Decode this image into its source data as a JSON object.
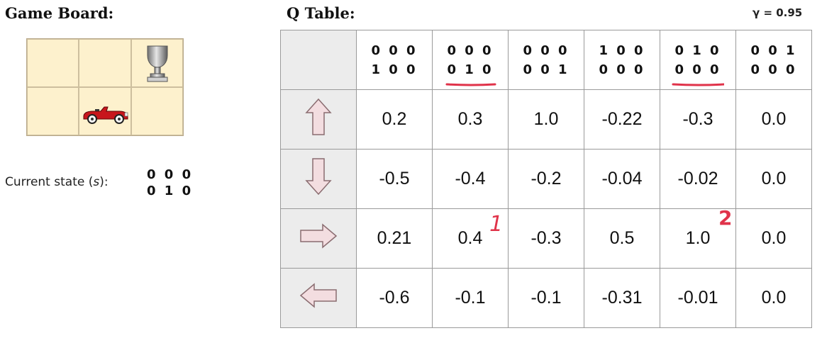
{
  "game_board": {
    "title": "Game Board:",
    "cells": [
      {
        "icon": ""
      },
      {
        "icon": ""
      },
      {
        "icon": "trophy-icon"
      },
      {
        "icon": ""
      },
      {
        "icon": "car-icon"
      },
      {
        "icon": ""
      }
    ],
    "colors": {
      "board_bg": "#fdf1cd",
      "car": "#c8161c",
      "trophy": "#9a9a9a"
    }
  },
  "current_state": {
    "label_prefix": "Current state (",
    "label_var": "s",
    "label_suffix": "):",
    "line1": "0 0 0",
    "line2": "0 1 0"
  },
  "q_table": {
    "title": "Q Table:",
    "gamma": "γ = 0.95",
    "columns": [
      {
        "line1": "0 0 0",
        "line2": "1 0 0",
        "underlined": false
      },
      {
        "line1": "0 0 0",
        "line2": "0 1 0",
        "underlined": true
      },
      {
        "line1": "0 0 0",
        "line2": "0 0 1",
        "underlined": false
      },
      {
        "line1": "1 0 0",
        "line2": "0 0 0",
        "underlined": false
      },
      {
        "line1": "0 1 0",
        "line2": "0 0 0",
        "underlined": true
      },
      {
        "line1": "0 0 1",
        "line2": "0 0 0",
        "underlined": false
      }
    ],
    "rows": [
      {
        "action": "up-arrow-icon",
        "values": [
          "0.2",
          "0.3",
          "1.0",
          "-0.22",
          "-0.3",
          "0.0"
        ]
      },
      {
        "action": "down-arrow-icon",
        "values": [
          "-0.5",
          "-0.4",
          "-0.2",
          "-0.04",
          "-0.02",
          "0.0"
        ]
      },
      {
        "action": "right-arrow-icon",
        "values": [
          "0.21",
          "0.4",
          "-0.3",
          "0.5",
          "1.0",
          "0.0"
        ]
      },
      {
        "action": "left-arrow-icon",
        "values": [
          "-0.6",
          "-0.1",
          "-0.1",
          "-0.31",
          "-0.01",
          "0.0"
        ]
      }
    ],
    "annotations": [
      "1",
      "2"
    ],
    "colors": {
      "arrow_fill": "#f3dde0",
      "arrow_stroke": "#8a6c70",
      "annotation": "#e0334a",
      "header_bg": "#ececec"
    }
  }
}
